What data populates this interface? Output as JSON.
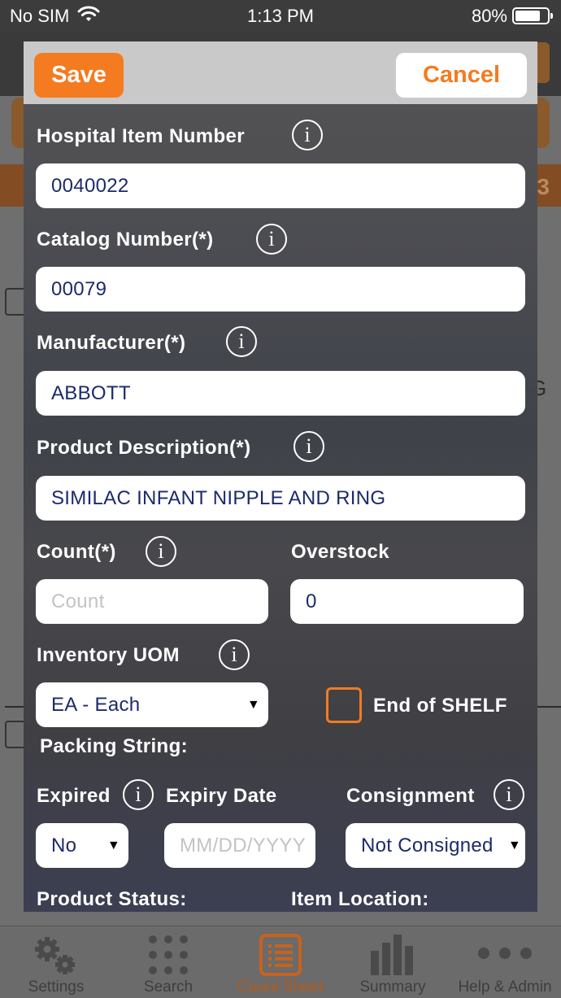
{
  "status_bar": {
    "carrier": "No SIM",
    "time": "1:13 PM",
    "battery_percent": "80%",
    "battery_level": 0.8
  },
  "background": {
    "strip_number": "3",
    "row_letter": "G",
    "partial_left": "0"
  },
  "modal": {
    "save_label": "Save",
    "cancel_label": "Cancel",
    "hospital_item_number": {
      "label": "Hospital Item Number",
      "value": "0040022"
    },
    "catalog_number": {
      "label": "Catalog Number(*)",
      "value": "00079"
    },
    "manufacturer": {
      "label": "Manufacturer(*)",
      "value": "ABBOTT"
    },
    "product_description": {
      "label": "Product Description(*)",
      "value": "SIMILAC INFANT NIPPLE AND RING"
    },
    "count": {
      "label": "Count(*)",
      "placeholder": "Count"
    },
    "overstock": {
      "label": "Overstock",
      "value": "0"
    },
    "inventory_uom": {
      "label": "Inventory UOM",
      "value": "EA - Each"
    },
    "end_of_shelf": {
      "label": "End of SHELF",
      "checked": false
    },
    "packing_string": {
      "label": "Packing String:"
    },
    "expired": {
      "label": "Expired",
      "value": "No"
    },
    "expiry_date": {
      "label": "Expiry Date",
      "placeholder": "MM/DD/YYYY"
    },
    "consignment": {
      "label": "Consignment",
      "value": "Not Consigned"
    },
    "product_status": {
      "label": "Product Status:"
    },
    "item_location": {
      "label": "Item Location:"
    },
    "info_glyph": "i",
    "dropdown_glyph": "▼"
  },
  "tabs": [
    {
      "label": "Settings",
      "icon": "gear-icon",
      "active": false
    },
    {
      "label": "Search",
      "icon": "grid-icon",
      "active": false
    },
    {
      "label": "Count Sheet",
      "icon": "list-icon",
      "active": true
    },
    {
      "label": "Summary",
      "icon": "bar-chart-icon",
      "active": false
    },
    {
      "label": "Help & Admin",
      "icon": "more-icon",
      "active": false
    }
  ],
  "colors": {
    "accent": "#f47b20",
    "field_text": "#1c2a6b",
    "placeholder": "#c3c3c3"
  }
}
